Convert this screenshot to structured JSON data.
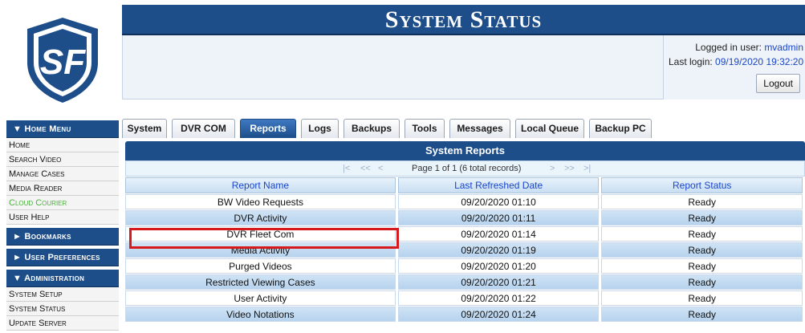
{
  "header": {
    "title": "System Status",
    "logged_in_label": "Logged in user:",
    "logged_in_user": "mvadmin",
    "last_login_label": "Last login:",
    "last_login_value": "09/19/2020 19:32:20",
    "logout_label": "Logout",
    "logo_text": "SF"
  },
  "sidebar": {
    "home_menu": {
      "label": "▼ Home Menu",
      "items": [
        "Home",
        "Search Video",
        "Manage Cases",
        "Media Reader",
        "Cloud Courier",
        "User Help"
      ]
    },
    "bookmarks_label": "► Bookmarks",
    "user_prefs_label": "► User Preferences",
    "admin": {
      "label": "▼ Administration",
      "items": [
        "System Setup",
        "System Status",
        "Update Server"
      ]
    }
  },
  "tabs": [
    "System",
    "DVR COM",
    "Reports",
    "Logs",
    "Backups",
    "Tools",
    "Messages",
    "Local Queue",
    "Backup PC"
  ],
  "active_tab": "Reports",
  "reports": {
    "title": "System Reports",
    "pager_text": "Page 1 of 1 (6 total records)",
    "columns": [
      "Report Name",
      "Last Refreshed Date",
      "Report Status"
    ],
    "rows": [
      [
        "BW Video Requests",
        "09/20/2020 01:10",
        "Ready"
      ],
      [
        "DVR Activity",
        "09/20/2020 01:11",
        "Ready"
      ],
      [
        "DVR Fleet Com",
        "09/20/2020 01:14",
        "Ready"
      ],
      [
        "Media Activity",
        "09/20/2020 01:19",
        "Ready"
      ],
      [
        "Purged Videos",
        "09/20/2020 01:20",
        "Ready"
      ],
      [
        "Restricted Viewing Cases",
        "09/20/2020 01:21",
        "Ready"
      ],
      [
        "User Activity",
        "09/20/2020 01:22",
        "Ready"
      ],
      [
        "Video Notations",
        "09/20/2020 01:24",
        "Ready"
      ]
    ]
  },
  "colors": {
    "brand_blue": "#1d4e8a",
    "link_blue": "#1a45c8",
    "highlight_red": "#d7191c",
    "cloud_green": "#4bb13d"
  }
}
